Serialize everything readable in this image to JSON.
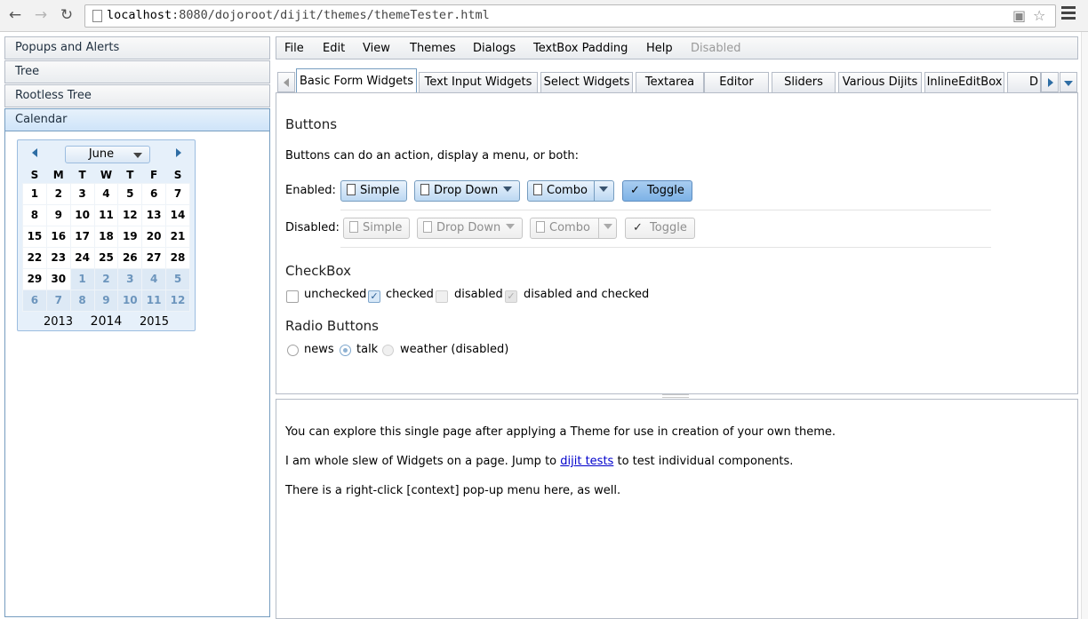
{
  "browser": {
    "url_host": "localhost",
    "url_rest": ":8080/dojoroot/dijit/themes/themeTester.html",
    "back_icon": "back-arrow-icon",
    "forward_icon": "forward-arrow-icon",
    "reload_icon": "reload-icon"
  },
  "accordion": {
    "items": [
      {
        "label": "Popups and Alerts"
      },
      {
        "label": "Tree"
      },
      {
        "label": "Rootless Tree"
      },
      {
        "label": "Calendar"
      }
    ],
    "selected": "Calendar"
  },
  "calendar": {
    "month": "June",
    "weekdays": [
      "S",
      "M",
      "T",
      "W",
      "T",
      "F",
      "S"
    ],
    "weeks": [
      [
        "1",
        "2",
        "3",
        "4",
        "5",
        "6",
        "7"
      ],
      [
        "8",
        "9",
        "10",
        "11",
        "12",
        "13",
        "14"
      ],
      [
        "15",
        "16",
        "17",
        "18",
        "19",
        "20",
        "21"
      ],
      [
        "22",
        "23",
        "24",
        "25",
        "26",
        "27",
        "28"
      ],
      [
        "29",
        "30",
        "1",
        "2",
        "3",
        "4",
        "5"
      ],
      [
        "6",
        "7",
        "8",
        "9",
        "10",
        "11",
        "12"
      ]
    ],
    "years": {
      "prev": "2013",
      "current": "2014",
      "next": "2015"
    }
  },
  "menubar": {
    "items": [
      "File",
      "Edit",
      "View",
      "Themes",
      "Dialogs",
      "TextBox Padding",
      "Help",
      "Disabled"
    ]
  },
  "tabs": [
    "Basic Form Widgets",
    "Text Input Widgets",
    "Select Widgets",
    "Textarea",
    "Editor",
    "Sliders",
    "Various Dijits",
    "InlineEditBox",
    "D"
  ],
  "selected_tab": "Basic Form Widgets",
  "buttons_section": {
    "title": "Buttons",
    "description": "Buttons can do an action, display a menu, or both:",
    "enabled_label": "Enabled:",
    "disabled_label": "Disabled:",
    "simple": "Simple",
    "dropdown": "Drop Down",
    "combo": "Combo",
    "toggle": "Toggle",
    "toggle_check": "✓"
  },
  "checkbox_section": {
    "title": "CheckBox",
    "unchecked": "unchecked",
    "checked": "checked",
    "disabled": "disabled",
    "disabled_checked": "disabled and checked",
    "check_mark": "✓"
  },
  "radio_section": {
    "title": "Radio Buttons",
    "news": "news",
    "talk": "talk",
    "weather": "weather (disabled)"
  },
  "info": {
    "line1": "You can explore this single page after applying a Theme for use in creation of your own theme.",
    "line2_before": "I am whole slew of Widgets on a page. Jump to",
    "line2_link": "dijit tests",
    "line2_after": "to test individual components.",
    "line3": "There is a right-click [context] pop-up menu here, as well."
  },
  "colors": {
    "accent": "#769dc0",
    "link": "#0000cc"
  }
}
